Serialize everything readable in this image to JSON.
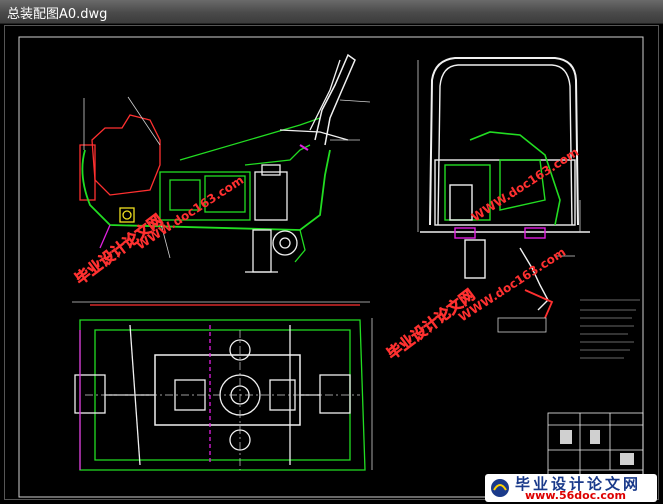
{
  "window": {
    "title": "总装配图A0.dwg"
  },
  "watermarks": {
    "cn_text": "毕业设计论文网",
    "url_text": "WWW.doc163.com",
    "footer_cn": "毕业设计论文网",
    "footer_url": "www.56doc.com"
  },
  "colors": {
    "frame": "#ff3b3b",
    "body_green": "#22dd22",
    "white_lines": "#f0f0f0",
    "magenta": "#e020e0",
    "cyan": "#20e0e0",
    "yellow": "#f0e020",
    "watermark_red": "#ff3030",
    "watermark_green": "#30ff30"
  }
}
